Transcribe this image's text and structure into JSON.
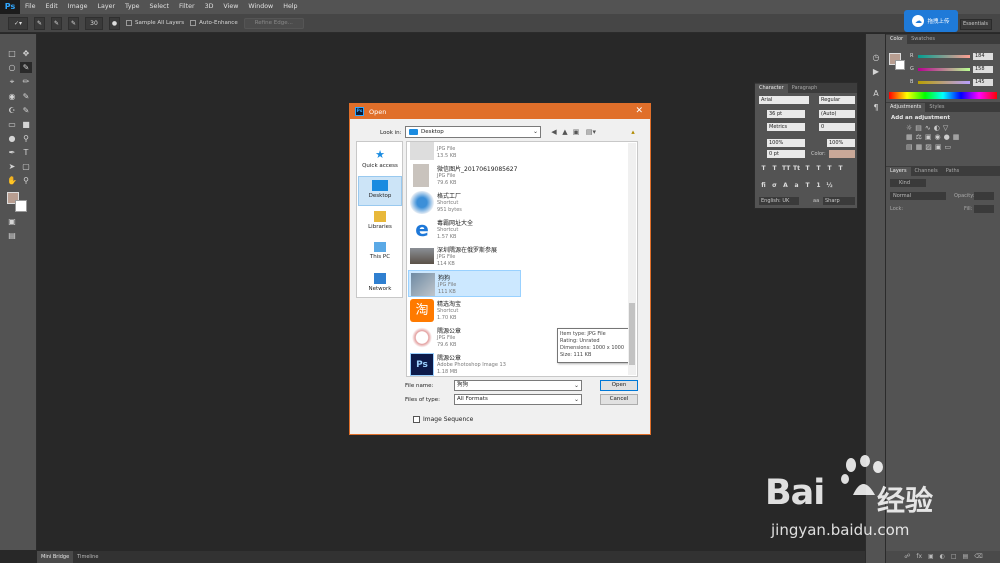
{
  "app": {
    "logo": "Ps",
    "menu": [
      "File",
      "Edit",
      "Image",
      "Layer",
      "Type",
      "Select",
      "Filter",
      "3D",
      "View",
      "Window",
      "Help"
    ]
  },
  "options_bar": {
    "brush_size": "30",
    "sample_all_layers": "Sample All Layers",
    "auto_enhance": "Auto-Enhance",
    "refine_edge": "Refine Edge...",
    "workspace": "Essentials",
    "upload_badge": "拖拽上传"
  },
  "bottom_tabs": [
    "Mini Bridge",
    "Timeline"
  ],
  "color_panel": {
    "tabs": [
      "Color",
      "Swatches"
    ],
    "r_label": "R",
    "r_value": "184",
    "g_label": "G",
    "g_value": "158",
    "b_label": "B",
    "b_value": "145",
    "swatch_color": "#b89e91"
  },
  "adjustments_panel": {
    "tabs": [
      "Adjustments",
      "Styles"
    ],
    "heading": "Add an adjustment"
  },
  "layers_panel": {
    "tabs": [
      "Layers",
      "Channels",
      "Paths"
    ],
    "kind": "Kind",
    "blend_mode": "Normal",
    "opacity_label": "Opacity:",
    "lock_label": "Lock:",
    "fill_label": "Fill:"
  },
  "character_panel": {
    "tabs": [
      "Character",
      "Paragraph"
    ],
    "font_family": "Arial",
    "font_style": "Regular",
    "font_size": "36 pt",
    "leading": "(Auto)",
    "kerning": "Metrics",
    "tracking": "0",
    "vscale": "100%",
    "hscale": "100%",
    "baseline": "0 pt",
    "color_label": "Color:",
    "language": "English: UK",
    "aa_label": "aa",
    "antialias": "Sharp",
    "text_color": "#c9a898"
  },
  "dialog": {
    "title": "Open",
    "look_in_label": "Look in:",
    "look_in_value": "Desktop",
    "places": [
      "Quick access",
      "Desktop",
      "Libraries",
      "This PC",
      "Network"
    ],
    "files": [
      {
        "name": "",
        "type": "JPG File",
        "size": "13.5 KB"
      },
      {
        "name": "微信图片_20170619085627",
        "type": "JPG File",
        "size": "79.6 KB"
      },
      {
        "name": "格式工厂",
        "type": "Shortcut",
        "size": "951 bytes"
      },
      {
        "name": "毒霸网址大全",
        "type": "Shortcut",
        "size": "1.57 KB"
      },
      {
        "name": "深圳隅源在俄罗斯参展",
        "type": "JPG File",
        "size": "114 KB"
      },
      {
        "name": "狗狗",
        "type": "JPG File",
        "size": "111 KB"
      },
      {
        "name": "精选淘宝",
        "type": "Shortcut",
        "size": "1.70 KB"
      },
      {
        "name": "隅源公章",
        "type": "JPG File",
        "size": "79.6 KB"
      },
      {
        "name": "隅源公章",
        "type": "Adobe Photoshop Image 13",
        "size": "1.18 MB"
      }
    ],
    "tooltip": {
      "item_type": "Item type: JPG File",
      "rating": "Rating: Unrated",
      "dimensions": "Dimensions: 1000 x 1000",
      "size": "Size: 111 KB"
    },
    "file_name_label": "File name:",
    "file_name_value": "狗狗",
    "files_of_type_label": "Files of type:",
    "files_of_type_value": "All Formats",
    "open_button": "Open",
    "cancel_button": "Cancel",
    "image_sequence": "Image Sequence"
  },
  "watermark": {
    "brand": "Bai",
    "brand2": "经验",
    "url": "jingyan.baidu.com"
  },
  "colors": {
    "accent_orange": "#e06f2a",
    "ps_blue": "#31a8ff",
    "selection_blue": "#cce8ff"
  }
}
